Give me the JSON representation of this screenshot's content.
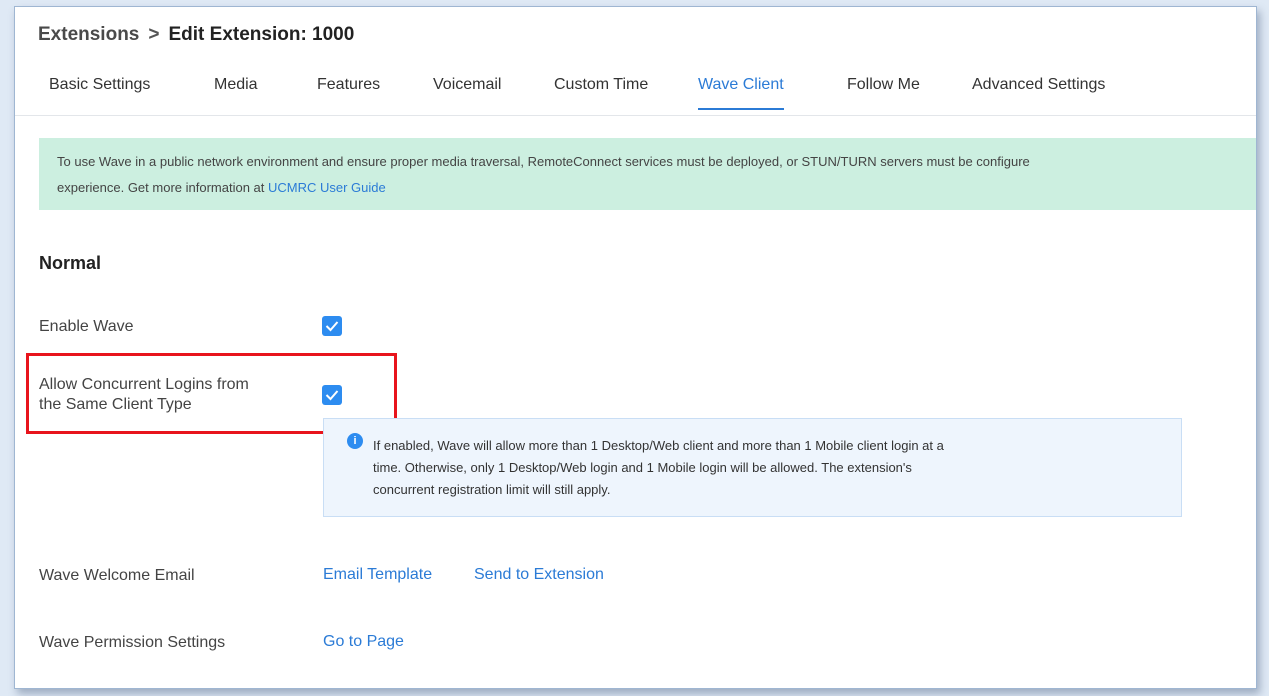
{
  "breadcrumb": {
    "root": "Extensions",
    "separator": ">",
    "current": "Edit Extension: 1000"
  },
  "tabs": [
    {
      "label": "Basic Settings"
    },
    {
      "label": "Media"
    },
    {
      "label": "Features"
    },
    {
      "label": "Voicemail"
    },
    {
      "label": "Custom Time"
    },
    {
      "label": "Wave Client",
      "active": true
    },
    {
      "label": "Follow Me"
    },
    {
      "label": "Advanced Settings"
    }
  ],
  "notice": {
    "line1": "To use Wave in a public network environment and ensure proper media traversal, RemoteConnect services must be deployed, or STUN/TURN servers must be configure",
    "line2_prefix": "experience. Get more information at ",
    "link": "UCMRC User Guide"
  },
  "section": {
    "title": "Normal"
  },
  "fields": {
    "enable_wave": {
      "label": "Enable Wave",
      "checked": true
    },
    "concurrent_logins": {
      "label_line1": "Allow Concurrent Logins from",
      "label_line2": "the Same Client Type",
      "checked": true
    },
    "welcome_email": {
      "label": "Wave Welcome Email",
      "link1": "Email Template",
      "link2": "Send to Extension"
    },
    "permission": {
      "label": "Wave Permission Settings",
      "link": "Go to Page"
    }
  },
  "info": {
    "icon": "info-icon",
    "icon_glyph": "i",
    "line1": "If enabled, Wave will allow more than 1 Desktop/Web client and more than 1 Mobile client login at a",
    "line2": "time. Otherwise, only 1 Desktop/Web login and 1 Mobile login will be allowed. The extension's",
    "line3": "concurrent registration limit will still apply."
  },
  "colors": {
    "accent": "#2b7bd6",
    "checkbox": "#2d8cf0",
    "notice_bg": "#ccefe0",
    "highlight": "#e8141c"
  }
}
